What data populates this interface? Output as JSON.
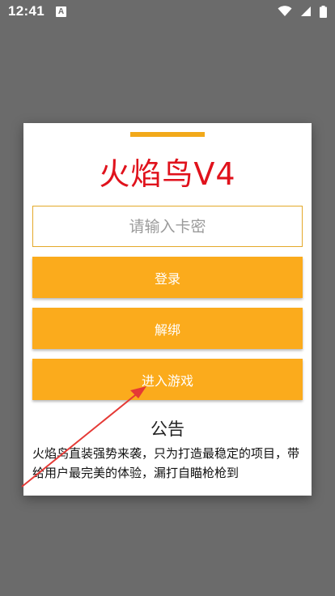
{
  "status_bar": {
    "time": "12:41",
    "app_badge": "A"
  },
  "dialog": {
    "title": "火焰鸟V4",
    "card_input": {
      "placeholder": "请输入卡密",
      "value": ""
    },
    "login_label": "登录",
    "unbind_label": "解绑",
    "enter_game_label": "进入游戏",
    "notice_title": "公告",
    "notice_text": "火焰鸟直装强势来袭，只为打造最稳定的项目，带给用户最完美的体验，漏打自瞄枪枪到"
  },
  "colors": {
    "accent": "#fbab1c",
    "title": "#e0121c",
    "backdrop": "#6b6b6b",
    "arrow": "#e53935"
  }
}
